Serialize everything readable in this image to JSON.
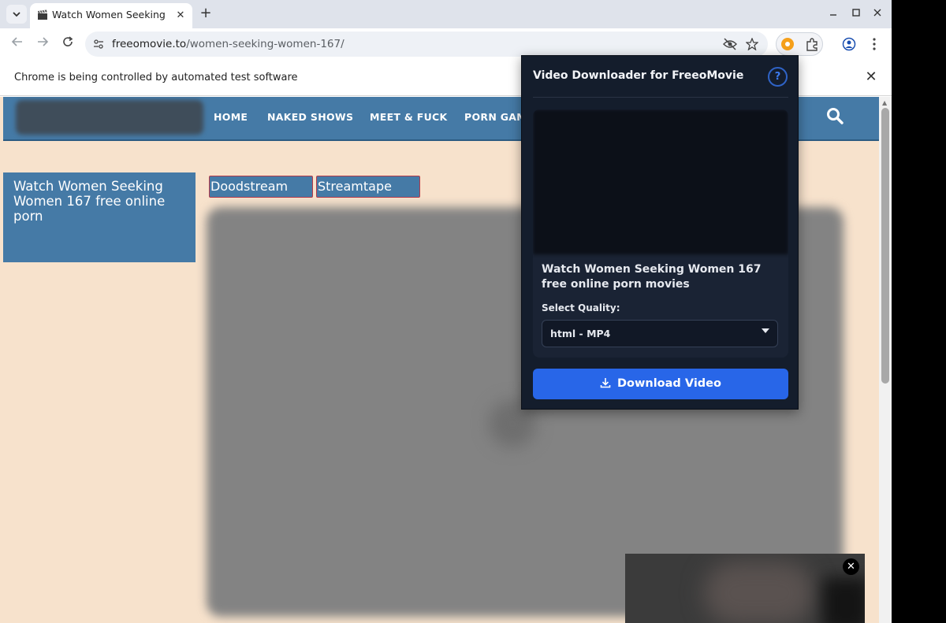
{
  "browser": {
    "tab_title": "Watch Women Seeking W",
    "tab_close": "✕",
    "new_tab": "+",
    "url_host": "freeomovie.to",
    "url_path": "/women-seeking-women-167/",
    "window_controls": [
      "–",
      "☐",
      "✕"
    ],
    "infobar_text": "Chrome is being controlled by automated test software",
    "infobar_close": "✕"
  },
  "site": {
    "nav": [
      "HOME",
      "NAKED SHOWS",
      "MEET & FUCK",
      "PORN GAM"
    ],
    "left_title": "Watch Women Seeking Women 167 free online porn",
    "servers": [
      "Doodstream",
      "Streamtape"
    ],
    "float_close": "✕"
  },
  "popup": {
    "title": "Video Downloader for FreeoMovie",
    "help": "?",
    "video_title": "Watch Women Seeking Women 167 free online porn movies",
    "quality_label": "Select Quality:",
    "quality_value": "html - MP4",
    "download_label": "Download Video",
    "accent": "#2866e8"
  }
}
